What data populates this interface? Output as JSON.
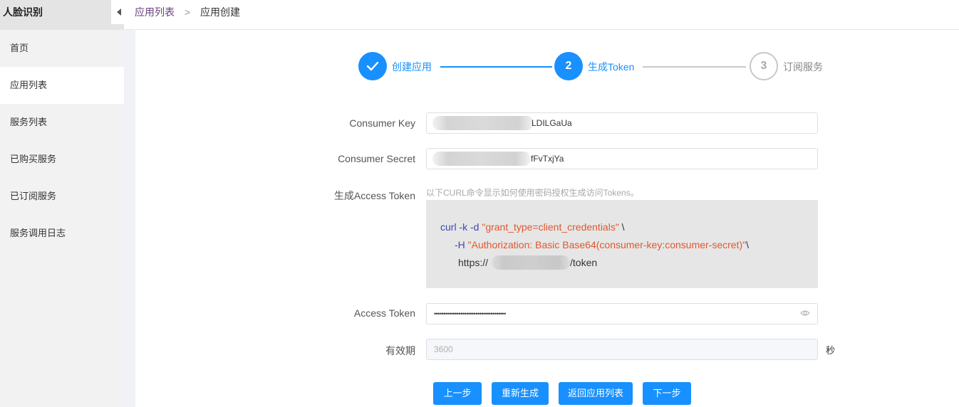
{
  "sidebar": {
    "title": "人脸识别",
    "items": [
      {
        "label": "首页"
      },
      {
        "label": "应用列表"
      },
      {
        "label": "服务列表"
      },
      {
        "label": "已购买服务"
      },
      {
        "label": "已订阅服务"
      },
      {
        "label": "服务调用日志"
      }
    ]
  },
  "breadcrumb": {
    "link": "应用列表",
    "separator": ">",
    "current": "应用创建"
  },
  "steps": [
    {
      "index": "1",
      "label": "创建应用",
      "status": "done"
    },
    {
      "index": "2",
      "label": "生成Token",
      "status": "current"
    },
    {
      "index": "3",
      "label": "订阅服务",
      "status": "wait"
    }
  ],
  "form": {
    "consumer_key": {
      "label": "Consumer Key",
      "value_visible": "LDILGaUa"
    },
    "consumer_secret": {
      "label": "Consumer Secret",
      "value_visible": "fFvTxjYa"
    },
    "access_token_gen": {
      "label": "生成Access Token",
      "hint": "以下CURL命令显示如何使用密码授权生成访问Tokens。",
      "code": {
        "line1_cmd": "curl -k -d ",
        "line1_str": "\"grant_type=client_credentials\"",
        "line1_tail": " \\",
        "line2_cmd": "-H ",
        "line2_str": "\"Authorization: Basic Base64(consumer-key:consumer-secret)\"",
        "line2_tail": "\\",
        "line3_prefix": "https://",
        "line3_suffix": "/token"
      }
    },
    "access_token": {
      "label": "Access Token",
      "value": "••••••••••••••••••••••••••••••••••••••"
    },
    "validity": {
      "label": "有效期",
      "value": "3600",
      "unit": "秒"
    }
  },
  "buttons": {
    "prev": "上一步",
    "regenerate": "重新生成",
    "back_to_list": "返回应用列表",
    "next": "下一步"
  },
  "colors": {
    "primary": "#1890ff",
    "sidebar_bg": "#f2f2f2",
    "code_bg": "#e6e6e6",
    "code_keyword": "#3b47b5",
    "code_string": "#e2572d"
  }
}
